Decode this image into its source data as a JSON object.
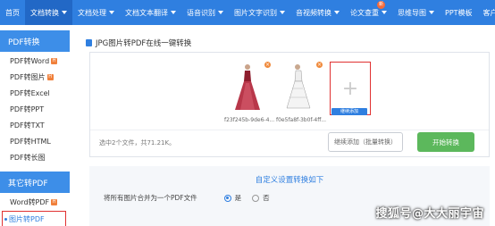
{
  "topnav": {
    "items": [
      {
        "label": "首页",
        "dropdown": false
      },
      {
        "label": "文档转换",
        "dropdown": true
      },
      {
        "label": "文档处理",
        "dropdown": true
      },
      {
        "label": "文档文本翻译",
        "dropdown": true
      },
      {
        "label": "语音识别",
        "dropdown": true
      },
      {
        "label": "图片文字识别",
        "dropdown": true
      },
      {
        "label": "音视频转换",
        "dropdown": true
      },
      {
        "label": "论文查重",
        "dropdown": true
      },
      {
        "label": "思维导图",
        "dropdown": true
      },
      {
        "label": "PPT模板",
        "dropdown": false
      },
      {
        "label": "客户端",
        "dropdown": true
      }
    ],
    "new_badge": "新",
    "accent": "#2f7fe0"
  },
  "sidebar": {
    "section1_title": "PDF转换",
    "section1_items": [
      {
        "label": "PDF转Word",
        "hot": true
      },
      {
        "label": "PDF转图片",
        "hot": true
      },
      {
        "label": "PDF转Excel",
        "hot": false
      },
      {
        "label": "PDF转PPT",
        "hot": false
      },
      {
        "label": "PDF转TXT",
        "hot": false
      },
      {
        "label": "PDF转HTML",
        "hot": false
      },
      {
        "label": "PDF转长图",
        "hot": false
      }
    ],
    "section2_title": "其它转PDF",
    "section2_items": [
      {
        "label": "Word转PDF",
        "hot": true
      },
      {
        "label": "图片转PDF",
        "hot": false
      }
    ],
    "hot_badge": "H"
  },
  "main": {
    "title": "JPG图片转PDF在线一键转换",
    "files": [
      {
        "name": "f23f245b-9de6-4..."
      },
      {
        "name": "f0e5fa8f-3b0f-4ff..."
      }
    ],
    "add_plus": "+",
    "add_caption": "继续添加",
    "file_count": "选中2个文件，共71.21K。",
    "more_button": "继续添加（批量转换）",
    "start_button": "开始转换",
    "delete_mark": "×",
    "settings_title": "自定义设置转换如下",
    "merge_label": "将所有图片合并为一个PDF文件",
    "option_yes": "是",
    "option_no": "否",
    "merge_selected": "是"
  },
  "watermark": "搜狐号@大大丽宇宙"
}
